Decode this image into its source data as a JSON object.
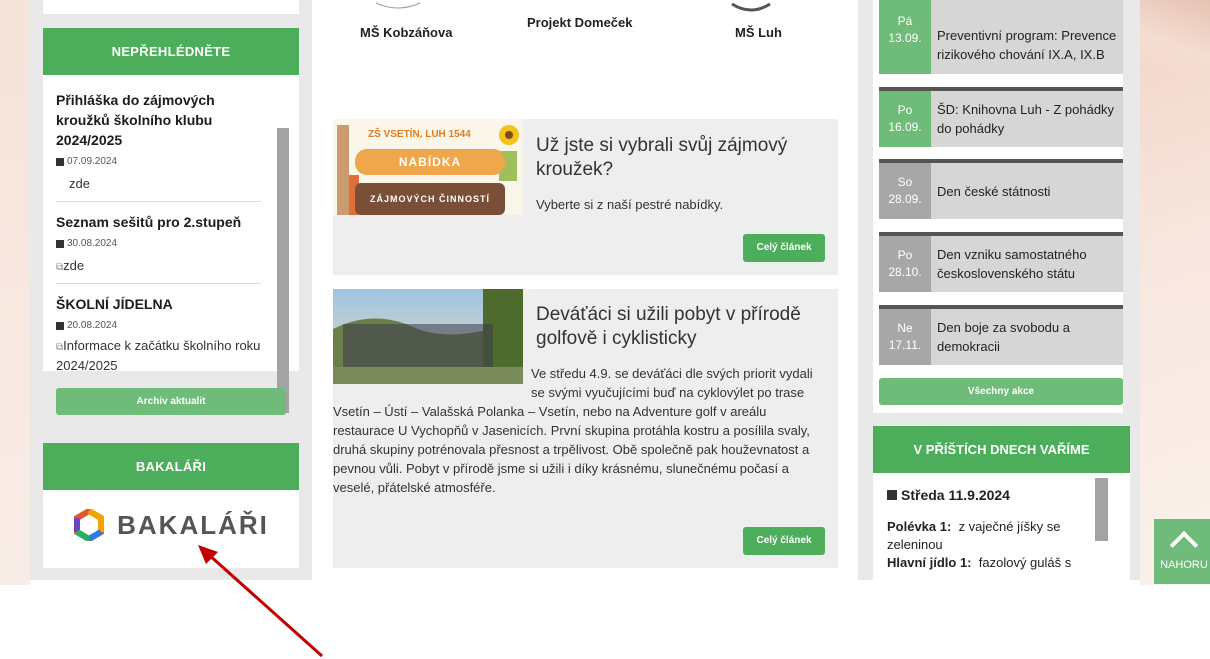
{
  "left": {
    "notice_title": "NEPŘEHLÉDNĚTE",
    "news": [
      {
        "title": "Přihláška do zájmových kroužků školního klubu 2024/2025",
        "date": "07.09.2024",
        "link": "zde"
      },
      {
        "title": "Seznam sešitů pro 2.stupeň",
        "date": "30.08.2024",
        "link": "zde"
      },
      {
        "title": "ŠKOLNÍ JÍDELNA",
        "date": "20.08.2024",
        "link": "Informace k začátku školního roku 2024/2025"
      }
    ],
    "archive_label": "Archiv aktualit",
    "bakalari_title": "BAKALÁŘI",
    "bakalari_logo_text": "BAKALÁŘI"
  },
  "top_logos": [
    {
      "label": "MŠ Kobzáňova"
    },
    {
      "label": "Projekt Domeček"
    },
    {
      "label": "MŠ Luh"
    }
  ],
  "articles": [
    {
      "title": "Už jste si vybrali svůj zájmový kroužek?",
      "text": "Vyberte si z naší pestré nabídky.",
      "button": "Celý článek",
      "image": {
        "school": "ZŠ VSETÍN, LUH 1544",
        "line1": "NABÍDKA",
        "line2": "ZÁJMOVÝCH ČINNOSTÍ"
      }
    },
    {
      "title": "Deváťáci si užili pobyt v přírodě golfově i cyklisticky",
      "text": "Ve středu 4.9. se deváťáci dle svých priorit vydali se svými vyučujícími buď na cyklovýlet po trase Vsetín – Ústí – Valašská Polanka – Vsetín, nebo na Adventure golf v areálu restaurace U Vychopňů v Jasenicích. První skupina protáhla kostru a posílila svaly, druhá skupiny potrénovala přesnost a trpělivost. Obě společně pak houževnatost a pevnou vůli. Pobyt v přírodě jsme si užili i díky krásnému, slunečnému počasí a veselé, přátelské atmosféře.",
      "button": "Celý článek"
    }
  ],
  "events": [
    {
      "day": "Pá",
      "date": "13.09.",
      "text": "Preventivní program: Prevence rizikového chování IX.A, IX.B",
      "color": "#6fbb79"
    },
    {
      "day": "Po",
      "date": "16.09.",
      "text": "ŠD: Knihovna Luh - Z pohádky do pohádky",
      "color": "#6fbb79"
    },
    {
      "day": "So",
      "date": "28.09.",
      "text": "Den české státnosti",
      "color": "#a7a7a7"
    },
    {
      "day": "Po",
      "date": "28.10.",
      "text": "Den vzniku samostatného československého státu",
      "color": "#a7a7a7"
    },
    {
      "day": "Ne",
      "date": "17.11.",
      "text": "Den boje za svobodu a demokracii",
      "color": "#a7a7a7"
    }
  ],
  "all_events_label": "Všechny akce",
  "menu": {
    "title": "V PŘÍŠTÍCH DNECH VAŘÍME",
    "day": "Středa 11.9.2024",
    "soup_label": "Polévka 1:",
    "soup": "z vaječné jíšky se zeleninou",
    "main_label": "Hlavní jídlo 1:",
    "main": "fazolový guláš s"
  },
  "nahoru_label": "NAHORU",
  "colors": {
    "green": "#4cae5a",
    "light_green": "#6fbb79",
    "arrow": "#c00000"
  }
}
